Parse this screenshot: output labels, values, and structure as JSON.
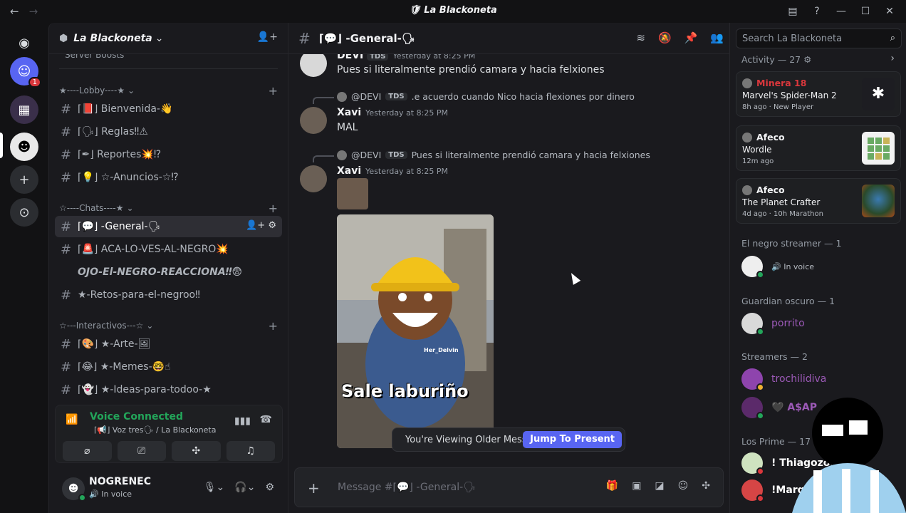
{
  "window": {
    "title": "La Blackoneta"
  },
  "guilds": {
    "home_badge": "1"
  },
  "server": {
    "name": "La Blackoneta"
  },
  "categories": [
    {
      "label": "★----Lobby----★"
    },
    {
      "label": "☆----Chats----★"
    },
    {
      "label": "☆---Interactivos---☆"
    }
  ],
  "channels": {
    "cut": "Server Boosts",
    "lobby": [
      {
        "name": "⌈📕⌋ Bienvenida-👋"
      },
      {
        "name": "⌈🗣⌋ Reglas‼⚠"
      },
      {
        "name": "⌈✒⌋ Reportes💥⁉"
      },
      {
        "name": "⌈💡⌋ ☆-Anuncios-☆⁉"
      }
    ],
    "chats": [
      {
        "name": "⌈💬⌋ -General-🗣"
      },
      {
        "name": "⌈🚨⌋ ACA-LO-VES-AL-NEGRO💥"
      },
      {
        "name": "OJO-El-NEGRO-REACCIONA‼😨"
      },
      {
        "name": "★-Retos-para-el-negroo‼"
      }
    ],
    "interactivos": [
      {
        "name": "⌈🎨⌋ ★-Arte-🖼"
      },
      {
        "name": "⌈😂⌋ ★-Memes-🤓☝"
      },
      {
        "name": "⌈👻⌋ ★-Ideas-para-todoo-★"
      }
    ]
  },
  "voice": {
    "status": "Voice Connected",
    "channel": "⌈📢⌋ Voz tres🗣 / La Blackoneta"
  },
  "user": {
    "name": "NOGRENEC",
    "status": "In voice"
  },
  "header": {
    "channel": "⌈💬⌋ -General-🗣"
  },
  "messages": {
    "m0": {
      "author": "DEVI",
      "tag": "TDS",
      "time": "Yesterday at 8:25 PM",
      "text": "Pues si literalmente prendió camara y hacia felxiones"
    },
    "m1": {
      "reply_author": "@DEVI",
      "reply_tag": "TDS",
      "reply_text": ".e acuerdo cuando Nico hacia flexiones por dinero",
      "author": "Xavi",
      "time": "Yesterday at 8:25 PM",
      "text": "MAL"
    },
    "m2": {
      "reply_author": "@DEVI",
      "reply_tag": "TDS",
      "reply_text": "Pues si literalmente prendió camara y hacia felxiones",
      "author": "Xavi",
      "time": "Yesterday at 8:25 PM"
    },
    "meme_caption": "Sale laburiño",
    "meme_watermark": "Her_Delvin"
  },
  "older_bar": {
    "text": "You're Viewing Older Messages",
    "button": "Jump To Present"
  },
  "composer": {
    "placeholder": "Message #⌈💬⌋ -General-🗣"
  },
  "search": {
    "placeholder": "Search La Blackoneta"
  },
  "activity": {
    "header": "Activity — 27",
    "cards": [
      {
        "user": "Minera 18",
        "game": "Marvel's Spider-Man 2",
        "meta": "8h ago  ·  New Player"
      },
      {
        "user": "Afeco",
        "game": "Wordle",
        "meta": "12m ago"
      },
      {
        "user": "Afeco",
        "game": "The Planet Crafter",
        "meta": "4d ago  ·  10h Marathon"
      }
    ]
  },
  "roles": [
    {
      "label": "El negro streamer — 1"
    },
    {
      "label": "Guardian oscuro — 1"
    },
    {
      "label": "Streamers — 2"
    },
    {
      "label": "Los Prime — 17"
    }
  ],
  "members": [
    {
      "name": "",
      "sub": "In voice"
    },
    {
      "name": "porrito"
    },
    {
      "name": "trochilidiva"
    },
    {
      "name": "A$AP"
    },
    {
      "name": "! Thiagozoo"
    },
    {
      "name": "!Marquit"
    }
  ]
}
